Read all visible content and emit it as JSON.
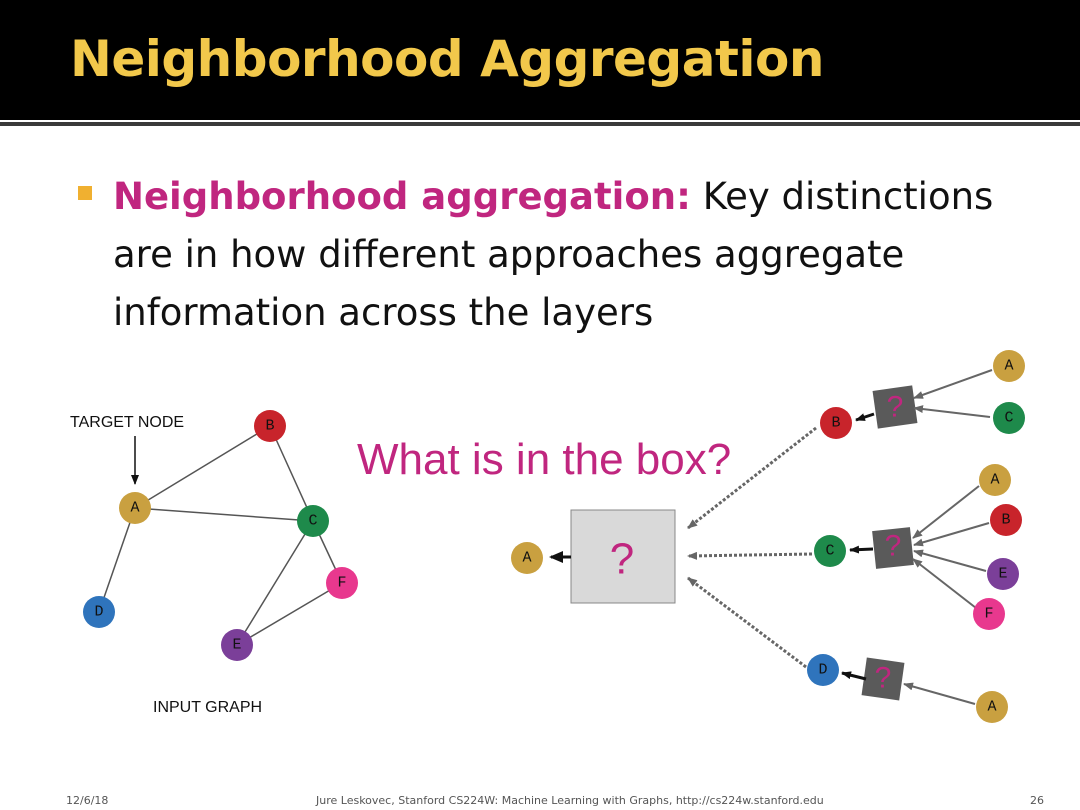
{
  "slide": {
    "title": "Neighborhood Aggregation",
    "bullet_emphasis": "Neighborhood aggregation:",
    "bullet_text": " Key distinctions are in how different approaches aggregate information across the layers"
  },
  "input_graph": {
    "target_label": "TARGET NODE",
    "caption": "INPUT GRAPH",
    "nodes": {
      "A": "A",
      "B": "B",
      "C": "C",
      "D": "D",
      "E": "E",
      "F": "F"
    }
  },
  "computation": {
    "question": "What is in the box?",
    "box_symbol": "?",
    "nodes": {
      "A": "A",
      "B": "B",
      "C": "C",
      "D": "D",
      "E": "E",
      "F": "F"
    }
  },
  "colors": {
    "A": "#c9a040",
    "B": "#c8242b",
    "C": "#1e8a4b",
    "D": "#2f74bc",
    "E": "#7b3f99",
    "F": "#e8388e",
    "title": "#f2c84b",
    "emphasis": "#c0267f",
    "question_box": "#5a5a5a"
  },
  "footer": {
    "date": "12/6/18",
    "credit": "Jure Leskovec, Stanford CS224W: Machine Learning with Graphs, http://cs224w.stanford.edu",
    "page": "26"
  }
}
